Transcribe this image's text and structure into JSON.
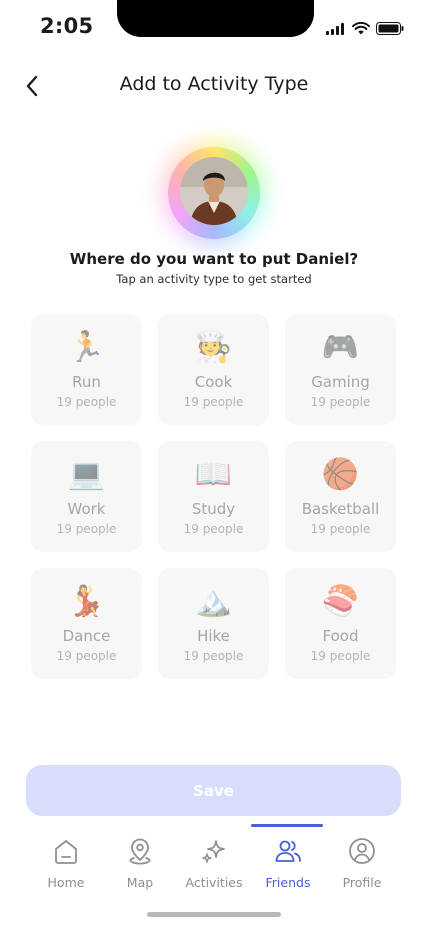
{
  "status_bar": {
    "time": "2:05"
  },
  "header": {
    "title": "Add to Activity Type"
  },
  "prompt": {
    "question": "Where do you want to put Daniel?",
    "hint": "Tap an activity type to get started"
  },
  "activities": [
    {
      "emoji": "🏃",
      "name": "Run",
      "count": "19 people"
    },
    {
      "emoji": "🧑‍🍳",
      "name": "Cook",
      "count": "19 people"
    },
    {
      "emoji": "🎮",
      "name": "Gaming",
      "count": "19 people"
    },
    {
      "emoji": "💻",
      "name": "Work",
      "count": "19 people"
    },
    {
      "emoji": "📖",
      "name": "Study",
      "count": "19 people"
    },
    {
      "emoji": "🏀",
      "name": "Basketball",
      "count": "19 people"
    },
    {
      "emoji": "💃",
      "name": "Dance",
      "count": "19 people"
    },
    {
      "emoji": "🏔️",
      "name": "Hike",
      "count": "19 people"
    },
    {
      "emoji": "🍣",
      "name": "Food",
      "count": "19 people"
    }
  ],
  "save_button": {
    "label": "Save"
  },
  "tabbar": {
    "tabs": [
      {
        "label": "Home",
        "icon": "home-icon",
        "active": false
      },
      {
        "label": "Map",
        "icon": "map-pin-icon",
        "active": false
      },
      {
        "label": "Activities",
        "icon": "sparkles-icon",
        "active": false
      },
      {
        "label": "Friends",
        "icon": "friends-icon",
        "active": true
      },
      {
        "label": "Profile",
        "icon": "profile-icon",
        "active": false
      }
    ]
  },
  "colors": {
    "accent": "#4a5fd6",
    "save_button_bg": "#d8ddfc",
    "card_bg": "#f8f7f7",
    "inactive_tab": "#8e8e93"
  }
}
